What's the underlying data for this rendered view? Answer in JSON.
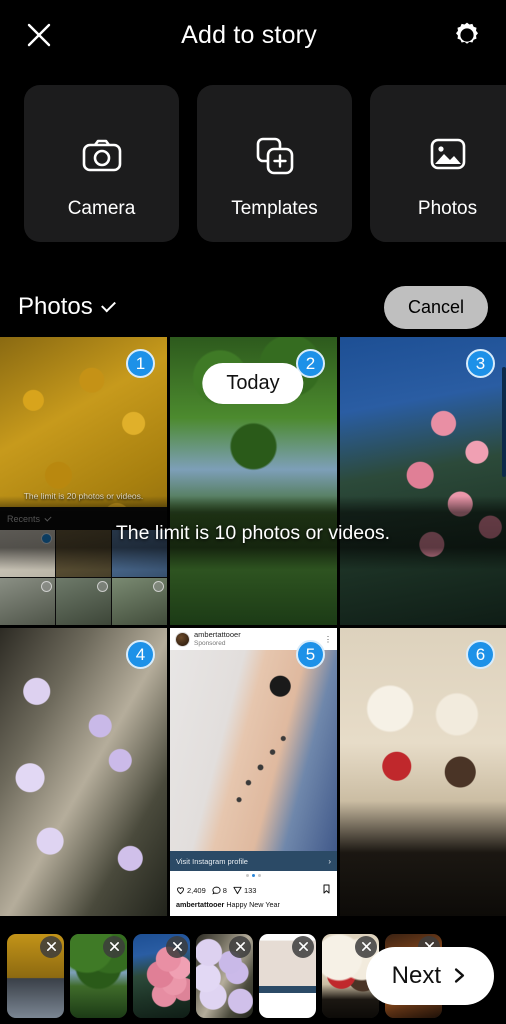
{
  "header": {
    "close_icon": "close-icon",
    "title": "Add to story",
    "settings_icon": "gear-icon"
  },
  "options": [
    {
      "label": "Camera",
      "icon": "camera-icon"
    },
    {
      "label": "Templates",
      "icon": "templates-icon"
    },
    {
      "label": "Photos",
      "icon": "photos-icon"
    }
  ],
  "picker_bar": {
    "album_label": "Photos",
    "album_chevron_icon": "chevron-down-icon",
    "cancel_label": "Cancel"
  },
  "date_chip": {
    "label": "Today"
  },
  "toast": {
    "message": "The limit is 10 photos or videos."
  },
  "grid": {
    "cells": [
      {
        "badge": "1",
        "art": "art-leaves",
        "name": "photo-cell-1-screenshot-gallery"
      },
      {
        "badge": "2",
        "art": "art-trees",
        "name": "photo-cell-2-garden-trees"
      },
      {
        "badge": "3",
        "art": "art-roses",
        "name": "photo-cell-3-pink-roses"
      },
      {
        "badge": "4",
        "art": "art-clematis",
        "name": "photo-cell-4-clematis-flowers"
      },
      {
        "badge": "5",
        "art": "ig",
        "name": "photo-cell-5-instagram-screenshot"
      },
      {
        "badge": "6",
        "art": "art-food",
        "name": "photo-cell-6-crepes-dessert"
      }
    ]
  },
  "nested_screenshot": {
    "limit_text": "The limit is 20 photos or videos.",
    "album_label": "Recents",
    "album_chevron_icon": "chevron-down-icon"
  },
  "instagram_post": {
    "username": "ambertattooer",
    "sponsored_label": "Sponsored",
    "more_icon": "more-options-icon",
    "cta_label": "Visit Instagram profile",
    "cta_arrow_icon": "chevron-right-icon",
    "like_icon": "heart-icon",
    "like_count": "2,409",
    "comment_icon": "comment-icon",
    "comment_count": "8",
    "share_icon": "share-icon",
    "share_count": "133",
    "save_icon": "bookmark-icon",
    "caption_user": "ambertattooer",
    "caption_text": " Happy New Year"
  },
  "tray": {
    "remove_icon": "close-icon",
    "thumbs": [
      {
        "art": "art-leaves",
        "name": "tray-thumb-1"
      },
      {
        "art": "art-trees",
        "name": "tray-thumb-2"
      },
      {
        "art": "art-roses",
        "name": "tray-thumb-3"
      },
      {
        "art": "art-clematis",
        "name": "tray-thumb-4"
      },
      {
        "art": "ig-thumb",
        "name": "tray-thumb-5"
      },
      {
        "art": "art-food",
        "name": "tray-thumb-6"
      },
      {
        "art": "art-turkey",
        "name": "tray-thumb-7"
      }
    ],
    "next_label": "Next",
    "next_arrow_icon": "chevron-right-icon"
  },
  "colors": {
    "background": "#000000",
    "card": "#1c1c1d",
    "badge_blue": "#1d91e8",
    "cancel_gray": "#bfbfbf",
    "next_white": "#ffffff"
  }
}
